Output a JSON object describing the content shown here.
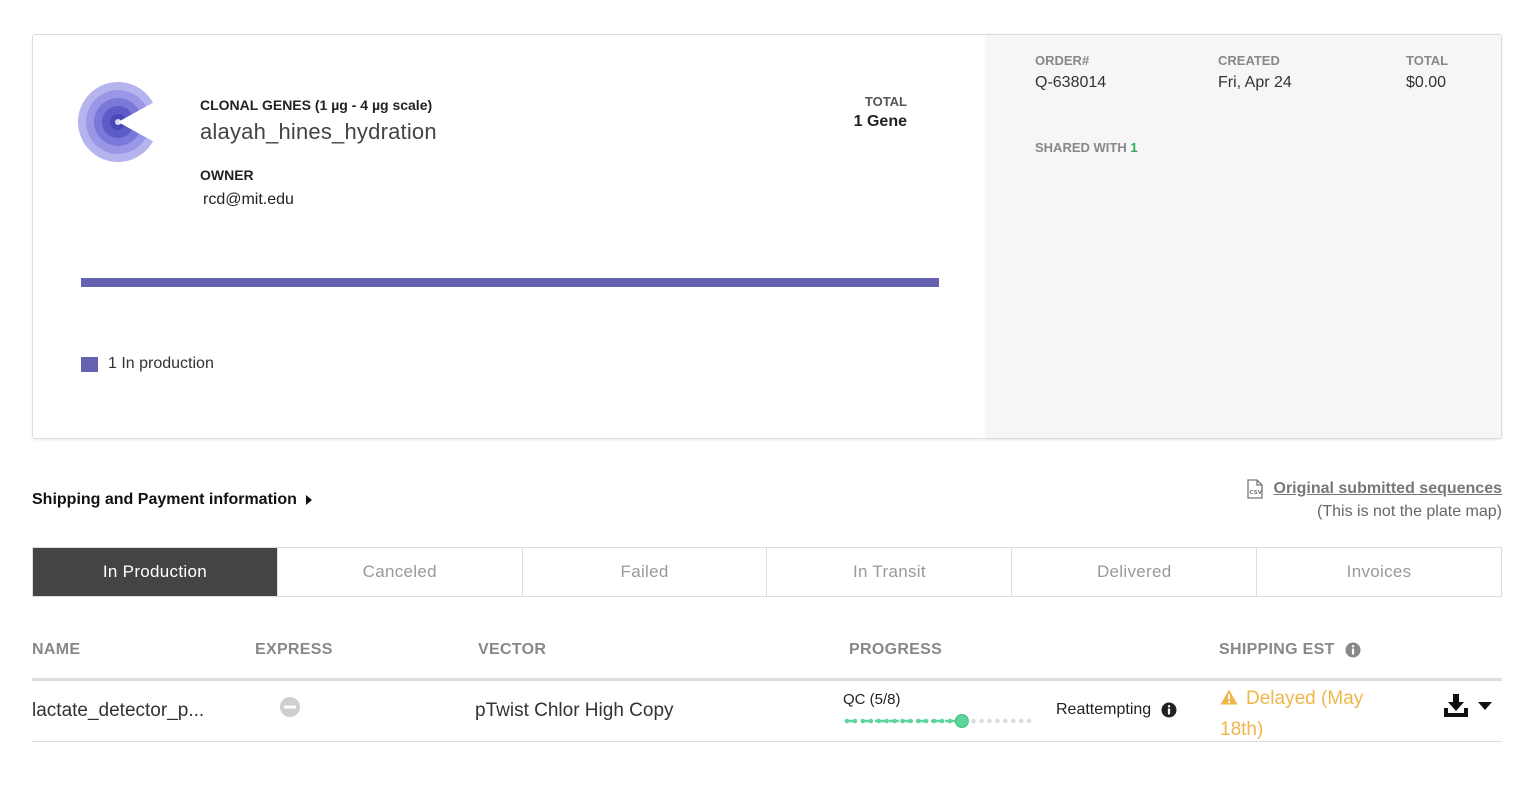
{
  "order": {
    "type_label": "CLONAL GENES (1 µg - 4 µg scale)",
    "name": "alayah_hines_hydration",
    "owner_label": "OWNER",
    "owner_value": "rcd@mit.edu",
    "total_label": "TOTAL",
    "total_value": "1 Gene",
    "legend_text": "1 In production",
    "production_fraction": 1.0,
    "accent_color": "#6462b1"
  },
  "meta": {
    "order_label": "ORDER#",
    "order_value": "Q-638014",
    "created_label": "CREATED",
    "created_value": "Fri, Apr 24",
    "total_label": "TOTAL",
    "total_value": "$0.00",
    "shared_label": "SHARED WITH",
    "shared_count": "1"
  },
  "shipping": {
    "toggle_label": "Shipping and Payment information"
  },
  "original": {
    "link_label": "Original submitted sequences",
    "note": "(This is not the plate map)",
    "icon": "csv-file-icon"
  },
  "tabs": [
    {
      "label": "In Production",
      "active": true
    },
    {
      "label": "Canceled",
      "active": false
    },
    {
      "label": "Failed",
      "active": false
    },
    {
      "label": "In Transit",
      "active": false
    },
    {
      "label": "Delivered",
      "active": false
    },
    {
      "label": "Invoices",
      "active": false
    }
  ],
  "table": {
    "headers": {
      "name": "NAME",
      "express": "EXPRESS",
      "vector": "VECTOR",
      "progress": "PROGRESS",
      "shipping": "SHIPPING EST"
    },
    "rows": [
      {
        "name": "lactate_detector_p...",
        "express_icon": "not-express-icon",
        "vector": "pTwist Chlor High Copy",
        "qc_label": "QC (5/8)",
        "qc_step": 5,
        "qc_total": 8,
        "status": "Reattempting",
        "shipping_est": "Delayed (May 18th)"
      }
    ]
  },
  "colors": {
    "progress_done": "#5fd49a",
    "progress_todo": "#dddddd",
    "warning": "#f1b64a",
    "tab_active_bg": "#444444"
  }
}
